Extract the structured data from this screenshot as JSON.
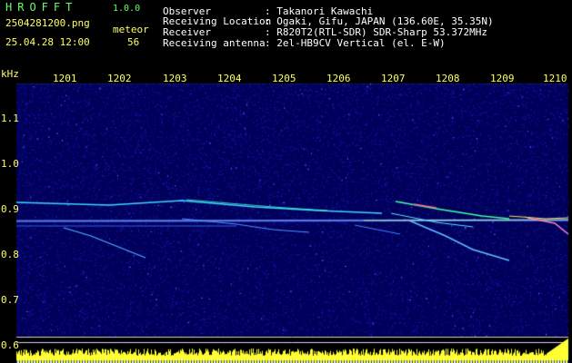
{
  "app": {
    "title": "HROFFT",
    "version": "1.0.0"
  },
  "file": {
    "name": "2504281200.png",
    "datetime": "25.04.28 12:00"
  },
  "meteor": {
    "label": "meteor",
    "count": "56"
  },
  "info": [
    {
      "key": "Observer",
      "value": ": Takanori Kawachi"
    },
    {
      "key": "Receiving Location",
      "value": ": Ogaki, Gifu, JAPAN (136.60E, 35.35N)"
    },
    {
      "key": "Receiver",
      "value": ": R820T2(RTL-SDR) SDR-Sharp 53.372MHz"
    },
    {
      "key": "Receiving antenna",
      "value": ": 2el-HB9CV Vertical (el. E-W)"
    }
  ],
  "axis": {
    "y_unit": "kHz",
    "y_ticks": [
      "1.1",
      "1.0",
      "0.9",
      "0.8",
      "0.7",
      "0.6"
    ],
    "x_ticks": [
      "1201",
      "1202",
      "1203",
      "1204",
      "1205",
      "1206",
      "1207",
      "1208",
      "1209",
      "1210"
    ]
  },
  "colors": {
    "header_green": "#66ff66",
    "header_yellow": "#ffff66",
    "background": "#000000",
    "spectrogram_base": "#000080"
  }
}
